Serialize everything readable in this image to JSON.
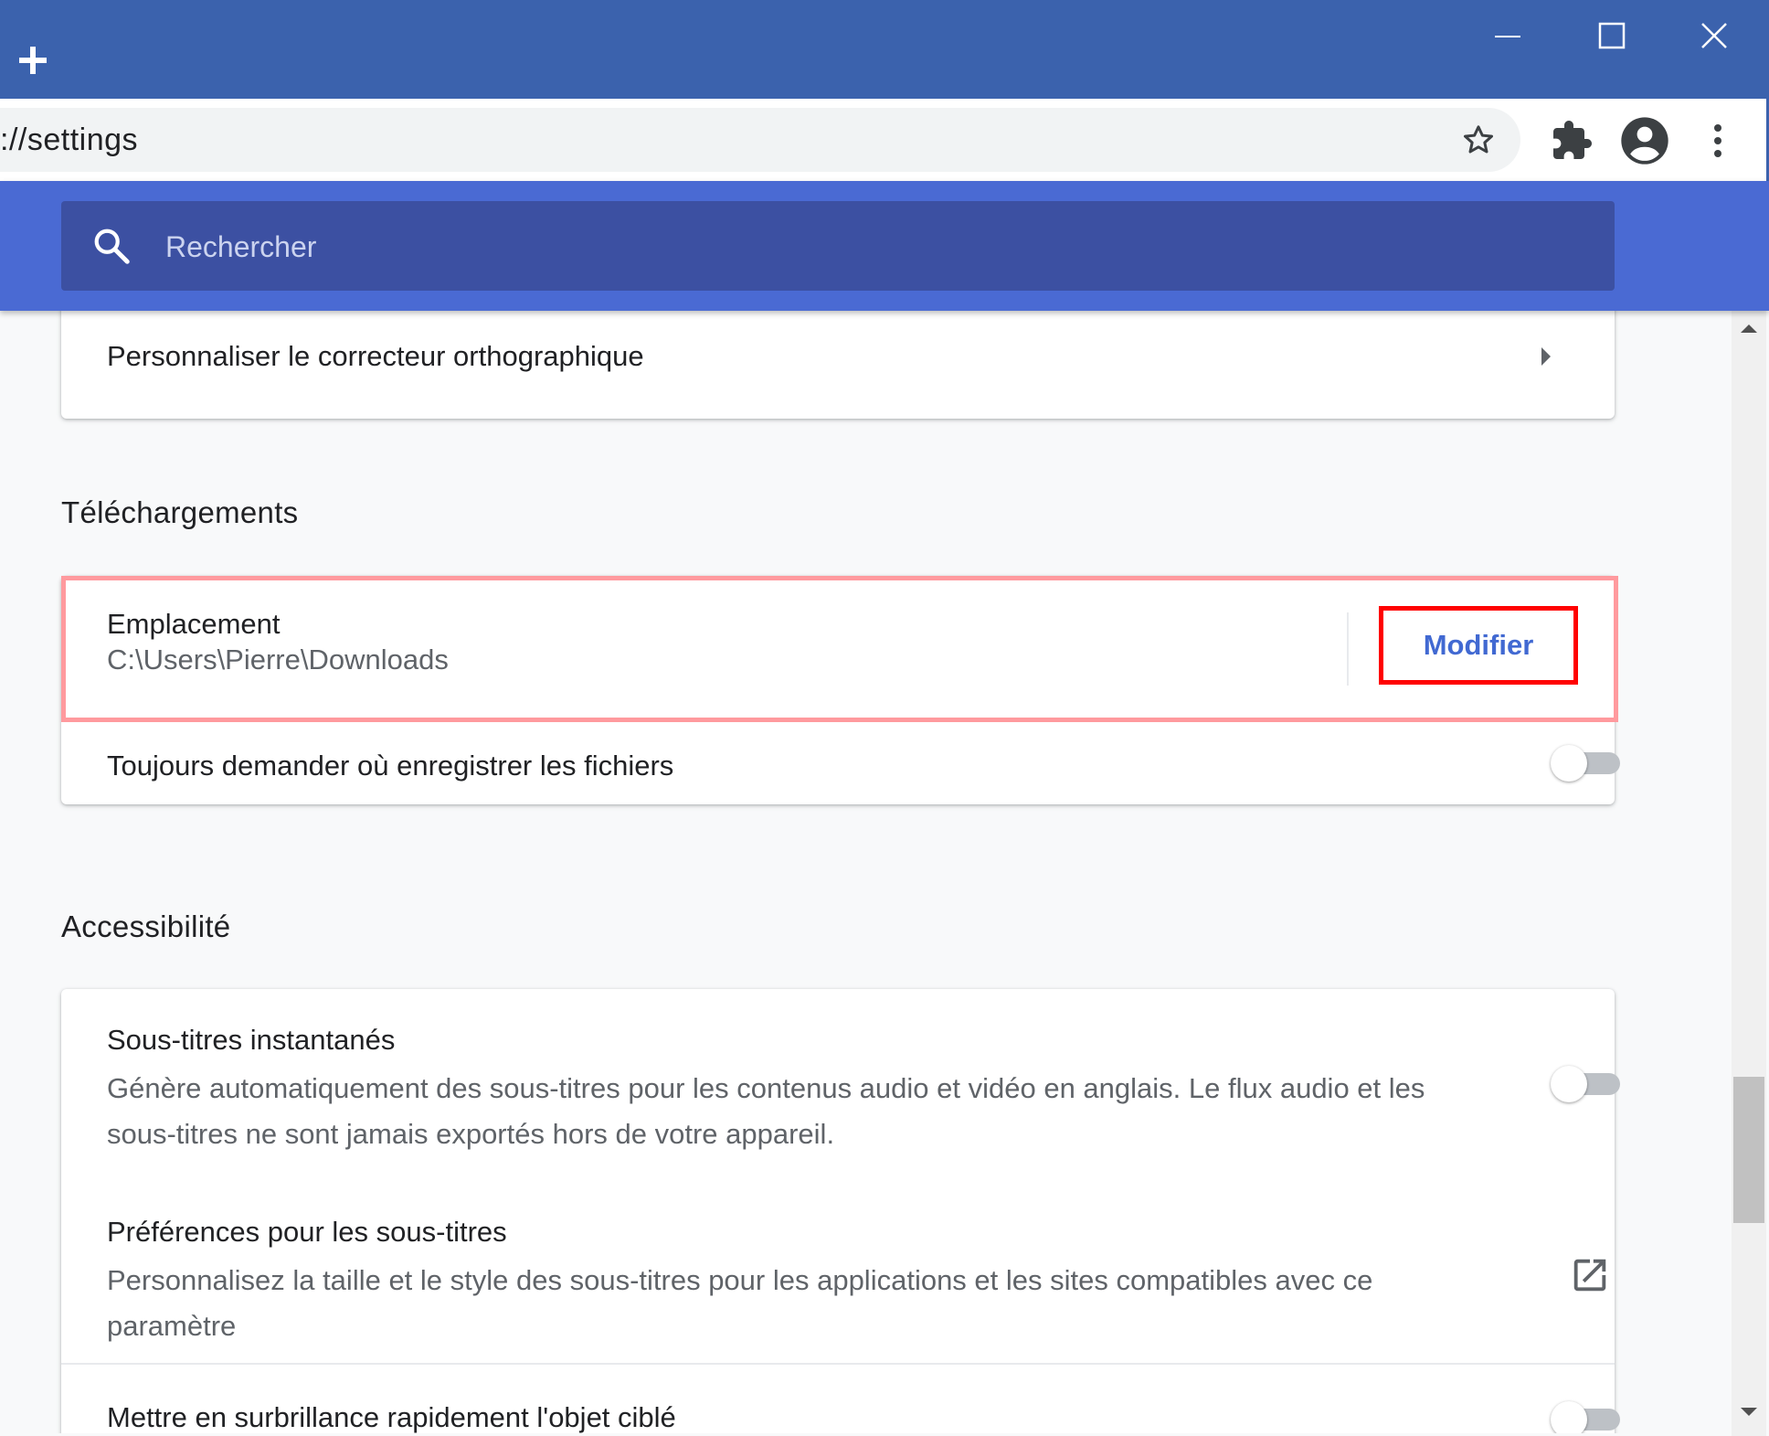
{
  "browser": {
    "url": "://settings",
    "icons": {
      "new_tab": "plus-icon",
      "minimize": "minimize-icon",
      "maximize": "maximize-icon",
      "close": "close-icon",
      "bookmark": "star-icon",
      "extensions": "puzzle-icon",
      "profile": "account-circle-icon",
      "menu": "more-vert-icon"
    },
    "colors": {
      "frame": "#3b62ad",
      "settings_header": "#4a6ad3",
      "search_box": "#3c50a2"
    }
  },
  "search": {
    "placeholder": "Rechercher",
    "value": ""
  },
  "spellcheck": {
    "label": "Personnaliser le correcteur orthographique"
  },
  "downloads": {
    "section_title": "Téléchargements",
    "location_label": "Emplacement",
    "location_path": "C:\\Users\\Pierre\\Downloads",
    "modify_button": "Modifier",
    "ask_label": "Toujours demander où enregistrer les fichiers",
    "ask_enabled": false
  },
  "accessibility": {
    "section_title": "Accessibilité",
    "live_caption_label": "Sous-titres instantanés",
    "live_caption_desc": "Génère automatiquement des sous-titres pour les contenus audio et vidéo en anglais. Le flux audio et les sous-titres ne sont jamais exportés hors de votre appareil.",
    "live_caption_enabled": false,
    "caption_prefs_label": "Préférences pour les sous-titres",
    "caption_prefs_desc": "Personnalisez la taille et le style des sous-titres pour les applications et les sites compatibles avec ce paramètre",
    "focus_highlight_label": "Mettre en surbrillance rapidement l'objet ciblé",
    "focus_highlight_enabled": false
  }
}
